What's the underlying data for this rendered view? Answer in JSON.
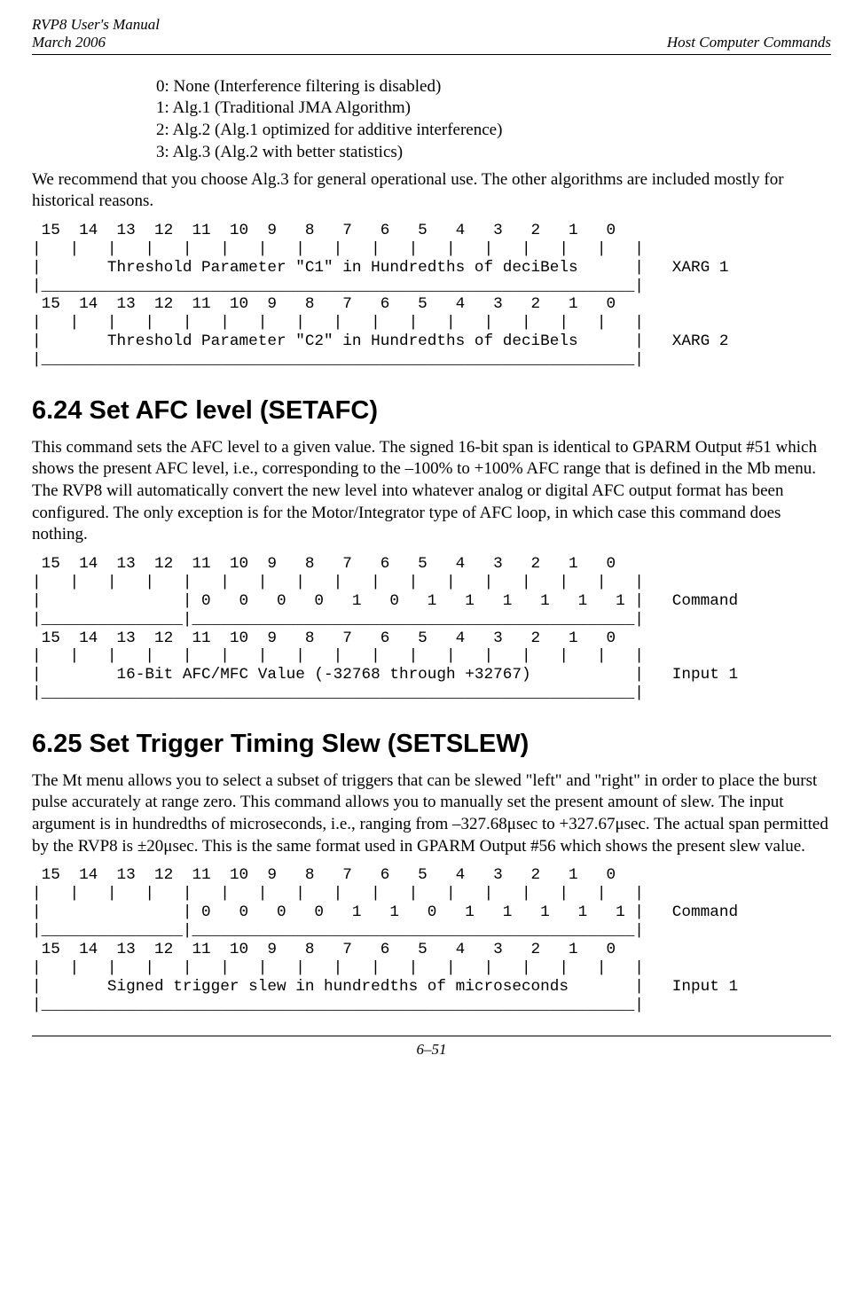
{
  "header": {
    "left_line1": "RVP8 User's Manual",
    "left_line2": "March 2006",
    "right": "Host Computer Commands"
  },
  "intro_list": {
    "i0": "0: None (Interference filtering is disabled)",
    "i1": "1: Alg.1 (Traditional JMA Algorithm)",
    "i2": "2: Alg.2 (Alg.1 optimized for additive interference)",
    "i3": "3: Alg.3 (Alg.2 with better statistics)"
  },
  "intro_para": "We recommend that you choose Alg.3 for general operational use.  The other algorithms are included mostly for historical reasons.",
  "diagram1": " 15  14  13  12  11  10  9   8   7   6   5   4   3   2   1   0  \n|   |   |   |   |   |   |   |   |   |   |   |   |   |   |   |   |\n|       Threshold Parameter \"C1\" in Hundredths of deciBels      |   XARG 1\n|_______________________________________________________________|\n 15  14  13  12  11  10  9   8   7   6   5   4   3   2   1   0  \n|   |   |   |   |   |   |   |   |   |   |   |   |   |   |   |   |\n|       Threshold Parameter \"C2\" in Hundredths of deciBels      |   XARG 2\n|_______________________________________________________________|",
  "section_624": {
    "title": "6.24     Set AFC level (SETAFC)",
    "para": "This command sets the AFC level to a given value.  The signed 16-bit span is identical to GPARM Output #51 which shows the present AFC level, i.e., corresponding to the –100% to +100% AFC range that is defined in the Mb menu.  The RVP8 will automatically convert the new level into whatever analog or digital AFC output format has been configured. The only exception is for the Motor/Integrator type of AFC loop, in which case this command does nothing."
  },
  "diagram2": " 15  14  13  12  11  10  9   8   7   6   5   4   3   2   1   0  \n|   |   |   |   |   |   |   |   |   |   |   |   |   |   |   |   |\n|               | 0   0   0   0   1   0   1   1   1   1   1   1 |   Command\n|_______________|_______________________________________________|\n 15  14  13  12  11  10  9   8   7   6   5   4   3   2   1   0  \n|   |   |   |   |   |   |   |   |   |   |   |   |   |   |   |   |\n|        16-Bit AFC/MFC Value (-32768 through +32767)           |   Input 1\n|_______________________________________________________________|",
  "section_625": {
    "title": "6.25     Set Trigger Timing Slew (SETSLEW)",
    "para": "The Mt menu allows you to select a subset of triggers that can be slewed \"left\" and \"right\" in order to place the burst pulse accurately at range zero.  This command allows you to manually set the present amount of slew.  The input argument is in hundredths of microseconds, i.e., ranging from –327.68μsec to +327.67μsec.  The actual span permitted by the RVP8 is ±20μsec.  This is the same format used in GPARM Output #56 which shows the present slew value."
  },
  "diagram3": " 15  14  13  12  11  10  9   8   7   6   5   4   3   2   1   0  \n|   |   |   |   |   |   |   |   |   |   |   |   |   |   |   |   |\n|               | 0   0   0   0   1   1   0   1   1   1   1   1 |   Command\n|_______________|_______________________________________________|\n 15  14  13  12  11  10  9   8   7   6   5   4   3   2   1   0  \n|   |   |   |   |   |   |   |   |   |   |   |   |   |   |   |   |\n|       Signed trigger slew in hundredths of microseconds       |   Input 1\n|_______________________________________________________________|",
  "footer": "6–51"
}
